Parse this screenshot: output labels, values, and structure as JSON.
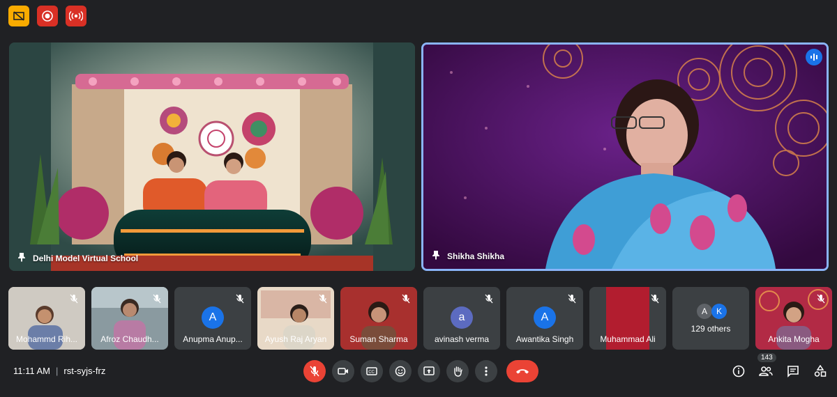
{
  "meeting": {
    "time": "11:11 AM",
    "separator": "|",
    "code": "rst-syjs-frz"
  },
  "top_icons": [
    "present-to-all-off-icon",
    "record-icon",
    "live-stream-icon"
  ],
  "main_tiles": [
    {
      "name": "Delhi Model Virtual School",
      "pinned": true
    },
    {
      "name": "Shikha Shikha",
      "pinned": true,
      "speaking": true
    }
  ],
  "participants": [
    {
      "name": "Mohammd Rih...",
      "muted": true,
      "video": true
    },
    {
      "name": "Afroz Chaudh...",
      "muted": true,
      "video": true
    },
    {
      "name": "Anupma Anup...",
      "muted": true,
      "avatar": "A",
      "avatar_color": "#1a73e8"
    },
    {
      "name": "Ayush Raj Aryan",
      "muted": true,
      "video": true
    },
    {
      "name": "Suman Sharma",
      "muted": true,
      "video": true
    },
    {
      "name": "avinash verma",
      "muted": true,
      "avatar": "a",
      "avatar_color": "#5c6bc0"
    },
    {
      "name": "Awantika Singh",
      "muted": true,
      "avatar": "A",
      "avatar_color": "#1a73e8"
    },
    {
      "name": "Muhammad Ali",
      "muted": true,
      "video": true
    },
    {
      "name": "129 others",
      "avatars": [
        "A",
        "K"
      ]
    },
    {
      "name": "Ankita Mogha",
      "muted": true,
      "video": true
    }
  ],
  "controls": [
    "mic-off-icon",
    "camera-icon",
    "captions-icon",
    "emoji-icon",
    "present-icon",
    "raise-hand-icon",
    "more-options-icon",
    "end-call-icon"
  ],
  "right_controls": {
    "people_count": "143"
  },
  "colors": {
    "accent": "#8ab4f8",
    "danger": "#ea4335",
    "surface": "#3c4043",
    "background": "#202124"
  }
}
